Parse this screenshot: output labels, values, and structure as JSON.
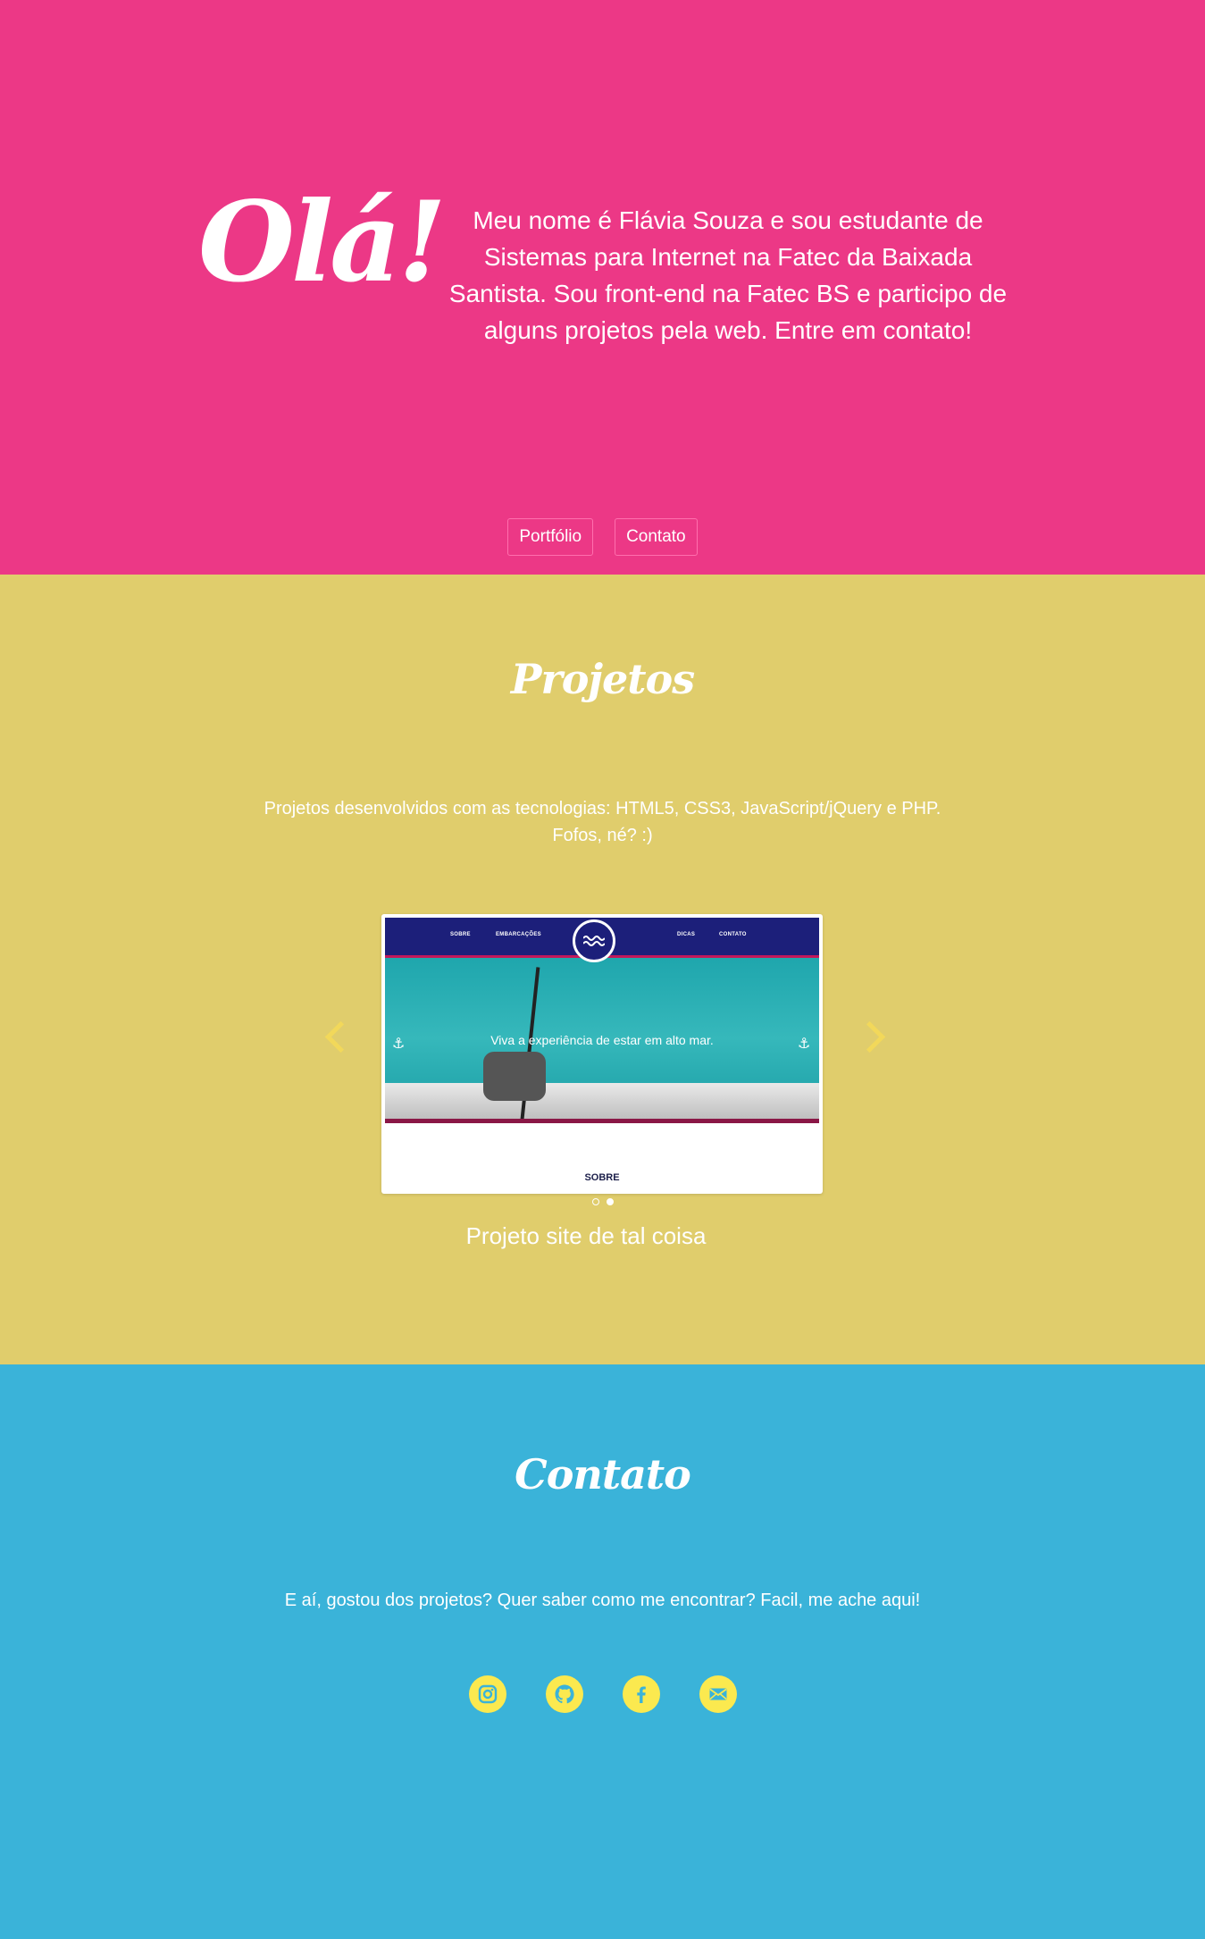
{
  "hero": {
    "greeting": "Olá!",
    "intro": "Meu nome é Flávia Souza e sou estudante de Sistemas para Internet na Fatec da Baixada Santista. Sou front-end na Fatec BS e participo de alguns projetos pela web. Entre em contato!",
    "nav": [
      {
        "label": "Portfólio"
      },
      {
        "label": "Contato"
      }
    ],
    "background": "#ec3886"
  },
  "projects": {
    "title": "Projetos",
    "description_line1": "Projetos desenvolvidos com as tecnologias: HTML5, CSS3, JavaScript/jQuery e PHP.",
    "description_line2": "Fofos, né? :)",
    "background": "#e0cd6c",
    "slide": {
      "nav_links": [
        "SOBRE",
        "EMBARCAÇÕES",
        "DICAS",
        "CONTATO"
      ],
      "caption": "Viva a experiência de estar em alto mar.",
      "section_label": "SOBRE"
    },
    "carousel_caption": "Projeto site de tal coisa",
    "slide_count": 2,
    "active_slide": 2
  },
  "contact": {
    "title": "Contato",
    "description": "E aí, gostou dos projetos? Quer saber como me encontrar? Facil, me ache aqui!",
    "background": "#3ab3d9",
    "socials": [
      "instagram-icon",
      "github-icon",
      "facebook-icon",
      "email-icon"
    ]
  }
}
